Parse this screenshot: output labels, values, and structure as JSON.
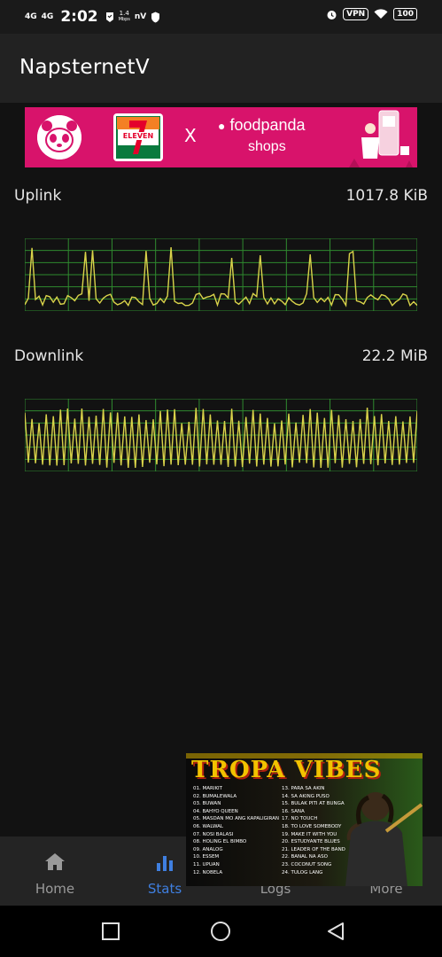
{
  "status_bar": {
    "signal1": "4G",
    "signal2": "4G",
    "time": "2:02",
    "speed_value": "1.4",
    "speed_unit": "Mbps",
    "carrier_tag": "nV",
    "vpn": "VPN",
    "battery": "100"
  },
  "app": {
    "title": "NapsternetV"
  },
  "ad_banner": {
    "brand_711": "ELEVEN",
    "separator": "X",
    "foodpanda": "foodpanda",
    "shops": "shops"
  },
  "uplink": {
    "label": "Uplink",
    "value": "1017.8 KiB",
    "line_color": "#d9d34a",
    "grid_color": "#2f8a2f"
  },
  "downlink": {
    "label": "Downlink",
    "value": "22.2 MiB",
    "line_color": "#d9d34a",
    "grid_color": "#2f8a2f"
  },
  "bottom_nav": {
    "items": [
      {
        "label": "Home",
        "icon": "home-icon",
        "active": false
      },
      {
        "label": "Stats",
        "icon": "stats-icon",
        "active": true
      },
      {
        "label": "Logs",
        "icon": "logs-icon",
        "active": false
      },
      {
        "label": "More",
        "icon": "more-icon",
        "active": false
      }
    ],
    "active_color": "#3f7fe0"
  },
  "overlay_ad": {
    "title": "TROPA VIBES",
    "tracks_left": [
      "01. MARIKIT",
      "02. BUMALEWALA",
      "03. BUWAN",
      "04. BAHYO QUEEN",
      "05. MASDAN MO ANG KAPALIGIRAN",
      "06. WALWAL",
      "07. NOSI BALASI",
      "08. HOLING EL BIMBO",
      "09. ANALOG",
      "10. ESSEM",
      "11. UPUAN",
      "12. NOBELA"
    ],
    "tracks_right": [
      "13. PARA SA AKIN",
      "14. SA AKING PUSO",
      "15. BULAK PITI AT BUNGA",
      "16. SANA",
      "17. NO TOUCH",
      "18. TO LOVE SOMEBODY",
      "19. MAKE IT WITH YOU",
      "20. ESTUDYANTE BLUES",
      "21. LEADER OF THE BAND",
      "22. BANAL NA ASO",
      "23. COCONUT SONG",
      "24. TULOG LANG"
    ]
  },
  "system_nav": {
    "recents": "square-icon",
    "home": "circle-icon",
    "back": "triangle-back-icon"
  }
}
